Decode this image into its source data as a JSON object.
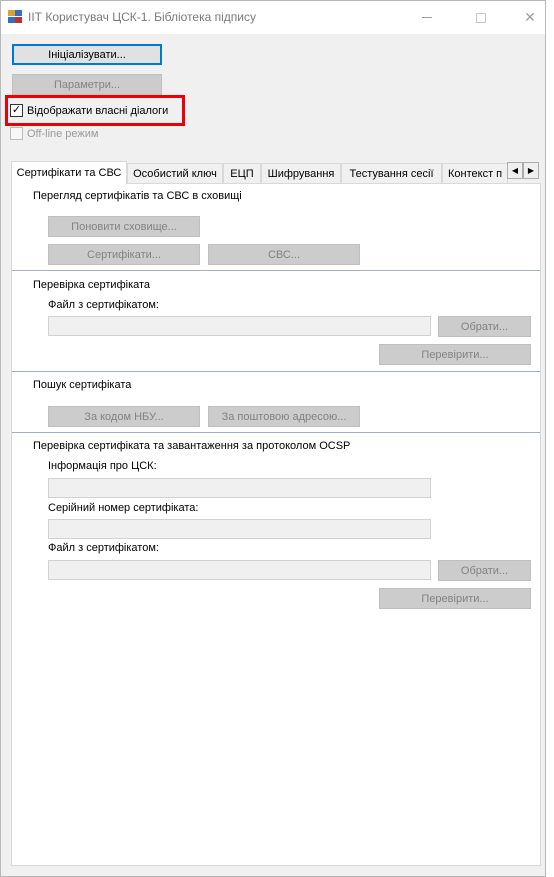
{
  "window": {
    "title": "ІІТ Користувач ЦСК-1. Бібліотека підпису",
    "close_glyph": "✕"
  },
  "top": {
    "initialize_label": "Ініціалізувати...",
    "parameters_label": "Параметри...",
    "show_own_dialogs_label": "Відображати власні діалоги",
    "show_own_dialogs_checked": true,
    "offline_label": "Off-line режим",
    "offline_checked": false,
    "check_glyph": "✓"
  },
  "tabs": [
    {
      "label": "Сертифікати та СВС",
      "active": true
    },
    {
      "label": "Особистий ключ",
      "active": false
    },
    {
      "label": "ЕЦП",
      "active": false
    },
    {
      "label": "Шифрування",
      "active": false
    },
    {
      "label": "Тестування сесії",
      "active": false
    },
    {
      "label": "Контекст п",
      "active": false
    }
  ],
  "scroll": {
    "left": "◀",
    "right": "▶"
  },
  "panel": {
    "view_group": {
      "title": "Перегляд сертифікатів та СВС в сховищі",
      "refresh_label": "Поновити сховище...",
      "certs_label": "Сертифікати...",
      "crl_label": "СВС..."
    },
    "check_group": {
      "title": "Перевірка сертифіката",
      "file_label": "Файл з сертифікатом:",
      "file_value": "",
      "browse_label": "Обрати...",
      "check_label": "Перевірити..."
    },
    "search_group": {
      "title": "Пошук сертифіката",
      "by_nbu_label": "За кодом НБУ...",
      "by_email_label": "За поштовою адресою..."
    },
    "ocsp_group": {
      "title": "Перевірка сертифіката та завантаження за протоколом OCSP",
      "ca_info_label": "Інформація про ЦСК:",
      "ca_info_value": "",
      "serial_label": "Серійний номер сертифіката:",
      "serial_value": "",
      "file_label": "Файл з сертифікатом:",
      "file_value": "",
      "browse_label": "Обрати...",
      "check_label": "Перевірити..."
    }
  }
}
